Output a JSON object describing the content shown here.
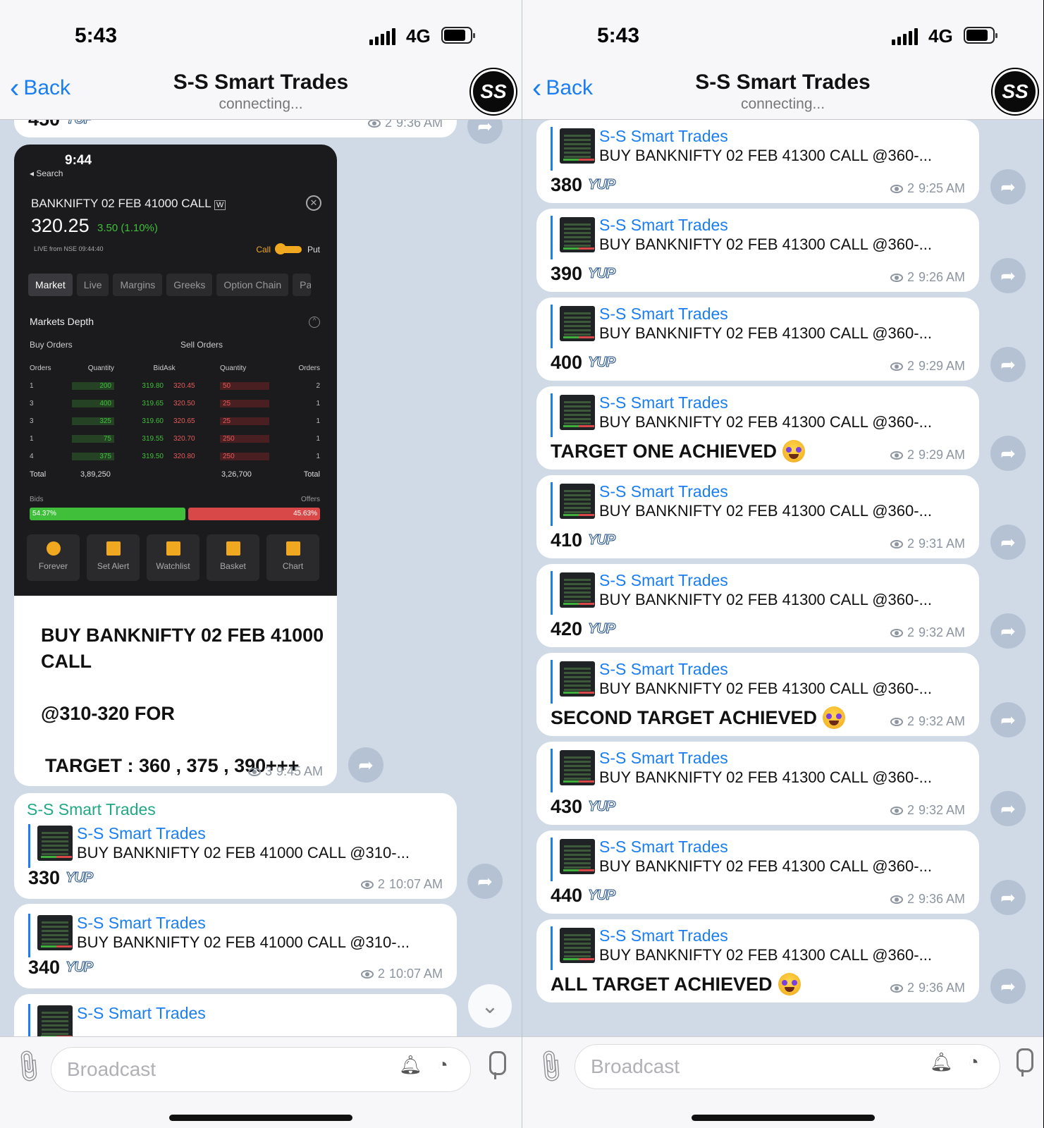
{
  "status": {
    "time": "5:43",
    "network": "4G"
  },
  "nav": {
    "back_label": "Back",
    "channel": "S-S Smart Trades",
    "subtitle": "connecting...",
    "avatar_text": "SS"
  },
  "left": {
    "top_partial": {
      "value": "450",
      "views": "2",
      "time": "9:36 AM"
    },
    "screenshot": {
      "time": "9:44",
      "search": "◂ Search",
      "title": "BANKNIFTY 02 FEB 41000 CALL",
      "badge": "W",
      "price": "320.25",
      "change": "3.50 (1.10%)",
      "live": "LIVE from NSE  09:44:40",
      "call": "Call",
      "put": "Put",
      "tabs": [
        "Market",
        "Live",
        "Margins",
        "Greeks",
        "Option Chain",
        "Pay"
      ],
      "depth_title": "Markets Depth",
      "buy_orders": "Buy Orders",
      "sell_orders": "Sell Orders",
      "headers": [
        "Orders",
        "Quantity",
        "Bid",
        "Ask",
        "Quantity",
        "Orders"
      ],
      "rows": [
        [
          "1",
          "200",
          "319.80",
          "320.45",
          "50",
          "2"
        ],
        [
          "3",
          "400",
          "319.65",
          "320.50",
          "25",
          "1"
        ],
        [
          "3",
          "325",
          "319.60",
          "320.65",
          "25",
          "1"
        ],
        [
          "1",
          "75",
          "319.55",
          "320.70",
          "250",
          "1"
        ],
        [
          "4",
          "375",
          "319.50",
          "320.80",
          "250",
          "1"
        ]
      ],
      "total_label": "Total",
      "buy_total": "3,89,250",
      "sell_total": "3,26,700",
      "bids_label": "Bids",
      "offers_label": "Offers",
      "bids_pct": "54.37%",
      "offers_pct": "45.63%",
      "bids_fraction": 0.5437,
      "actions": [
        "Forever",
        "Set Alert",
        "Watchlist",
        "Basket",
        "Chart"
      ]
    },
    "signal_lines": [
      "BUY BANKNIFTY 02 FEB 41000",
      "CALL",
      "",
      "@310-320 FOR",
      "",
      "TARGET : 360 , 375 , 390+++"
    ],
    "signal_views": "3",
    "signal_time": "9:45 AM",
    "forward_sender": "S-S Smart Trades",
    "replies": [
      {
        "name": "S-S Smart Trades",
        "text": "BUY BANKNIFTY 02 FEB 41000  CALL  @310-...",
        "value": "330",
        "views": "2",
        "time": "10:07 AM"
      },
      {
        "name": "S-S Smart Trades",
        "text": "BUY BANKNIFTY 02 FEB 41000  CALL  @310-...",
        "value": "340",
        "views": "2",
        "time": "10:07 AM"
      },
      {
        "name": "S-S Smart Trades",
        "text": "",
        "value": "",
        "views": "",
        "time": ""
      }
    ]
  },
  "yup_text": "YUP",
  "right": {
    "messages": [
      {
        "name": "S-S Smart Trades",
        "text": "BUY BANKNIFTY 02 FEB 41300  CALL  @360-...",
        "value": "380",
        "views": "2",
        "time": "9:25 AM",
        "yup": true
      },
      {
        "name": "S-S Smart Trades",
        "text": "BUY BANKNIFTY 02 FEB 41300  CALL  @360-...",
        "value": "390",
        "views": "2",
        "time": "9:26 AM",
        "yup": true
      },
      {
        "name": "S-S Smart Trades",
        "text": "BUY BANKNIFTY 02 FEB 41300  CALL  @360-...",
        "value": "400",
        "views": "2",
        "time": "9:29 AM",
        "yup": true
      },
      {
        "name": "S-S Smart Trades",
        "text": "BUY BANKNIFTY 02 FEB 41300  CALL  @360-...",
        "value": "TARGET ONE ACHIEVED",
        "views": "2",
        "time": "9:29 AM",
        "yup": false
      },
      {
        "name": "S-S Smart Trades",
        "text": "BUY BANKNIFTY 02 FEB 41300  CALL  @360-...",
        "value": "410",
        "views": "2",
        "time": "9:31 AM",
        "yup": true
      },
      {
        "name": "S-S Smart Trades",
        "text": "BUY BANKNIFTY 02 FEB 41300  CALL  @360-...",
        "value": "420",
        "views": "2",
        "time": "9:32 AM",
        "yup": true
      },
      {
        "name": "S-S Smart Trades",
        "text": "BUY BANKNIFTY 02 FEB 41300  CALL  @360-...",
        "value": "SECOND TARGET  ACHIEVED",
        "views": "2",
        "time": "9:32 AM",
        "yup": false
      },
      {
        "name": "S-S Smart Trades",
        "text": "BUY BANKNIFTY 02 FEB 41300  CALL  @360-...",
        "value": "430",
        "views": "2",
        "time": "9:32 AM",
        "yup": true
      },
      {
        "name": "S-S Smart Trades",
        "text": "BUY BANKNIFTY 02 FEB 41300  CALL  @360-...",
        "value": "440",
        "views": "2",
        "time": "9:36 AM",
        "yup": true
      },
      {
        "name": "S-S Smart Trades",
        "text": "BUY BANKNIFTY 02 FEB 41300  CALL  @360-...",
        "value": "ALL TARGET  ACHIEVED",
        "views": "2",
        "time": "9:36 AM",
        "yup": false
      }
    ]
  },
  "composer": {
    "placeholder": "Broadcast"
  },
  "colors": {
    "accent": "#1a7ef2",
    "chat_bg": "#cfdae6",
    "forward_name": "#22a884"
  }
}
